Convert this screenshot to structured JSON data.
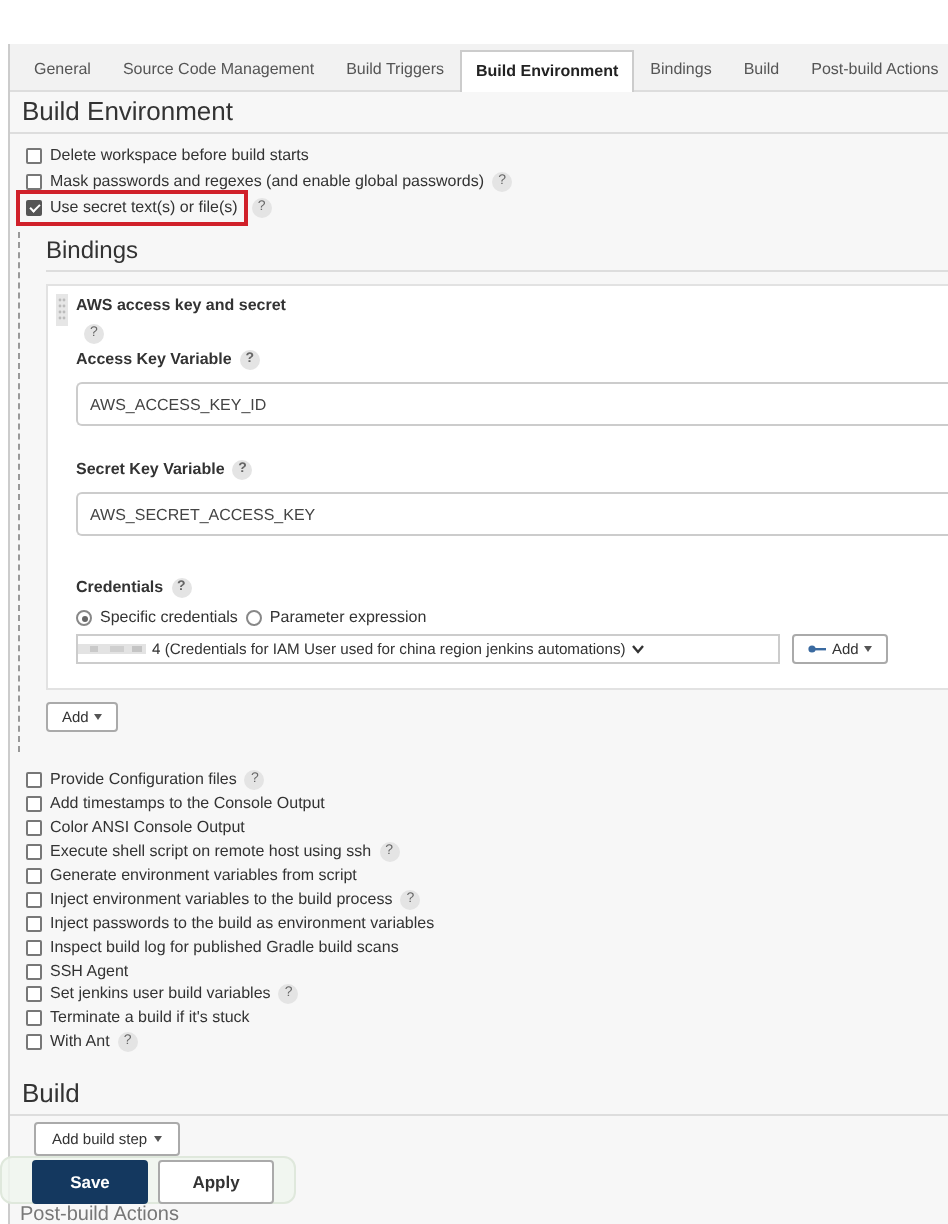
{
  "tabs": [
    {
      "label": "General",
      "selected": false
    },
    {
      "label": "Source Code Management",
      "selected": false
    },
    {
      "label": "Build Triggers",
      "selected": false
    },
    {
      "label": "Build Environment",
      "selected": true
    },
    {
      "label": "Bindings",
      "selected": false
    },
    {
      "label": "Build",
      "selected": false
    },
    {
      "label": "Post-build Actions",
      "selected": false
    }
  ],
  "build_environment": {
    "title": "Build Environment",
    "options": [
      {
        "label": "Delete workspace before build starts",
        "checked": false,
        "highlighted": false
      },
      {
        "label": "Mask passwords and regexes (and enable global passwords)",
        "checked": false,
        "highlighted": false,
        "help": "?"
      },
      {
        "label": "Use secret text(s) or file(s)",
        "checked": true,
        "highlighted": true,
        "help": "?"
      }
    ]
  },
  "bindings": {
    "title": "Bindings",
    "binding": {
      "title": "AWS access key and secret",
      "help": "?",
      "fields": [
        {
          "label": "Access Key Variable",
          "help": "?",
          "value": "AWS_ACCESS_KEY_ID"
        },
        {
          "label": "Secret Key Variable",
          "help": "?",
          "value": "AWS_SECRET_ACCESS_KEY"
        }
      ],
      "credentials": {
        "label": "Credentials",
        "help": "?",
        "options": [
          {
            "label": "Specific credentials",
            "selected": true
          },
          {
            "label": "Parameter expression",
            "selected": false
          }
        ],
        "value": "4 (Credentials for IAM User used for china region jenkins automations)",
        "add_button": "Add"
      }
    },
    "add_button": "Add"
  },
  "more_options": [
    {
      "label": "Provide Configuration files",
      "checked": false,
      "help": "?"
    },
    {
      "label": "Add timestamps to the Console Output",
      "checked": false
    },
    {
      "label": "Color ANSI Console Output",
      "checked": false
    },
    {
      "label": "Execute shell script on remote host using ssh",
      "checked": false,
      "help": "?"
    },
    {
      "label": "Generate environment variables from script",
      "checked": false
    },
    {
      "label": "Inject environment variables to the build process",
      "checked": false,
      "help": "?"
    },
    {
      "label": "Inject passwords to the build as environment variables",
      "checked": false
    },
    {
      "label": "Inspect build log for published Gradle build scans",
      "checked": false
    },
    {
      "label": "SSH Agent",
      "checked": false
    },
    {
      "label": "Set jenkins user build variables",
      "checked": false,
      "help": "?"
    },
    {
      "label": "Terminate a build if it's stuck",
      "checked": false
    },
    {
      "label": "With Ant",
      "checked": false,
      "help": "?"
    }
  ],
  "build": {
    "title": "Build",
    "add_step_button": "Add build step"
  },
  "post_build": {
    "title": "Post-build Actions"
  },
  "save_bar": {
    "buttons": [
      {
        "label": "Save",
        "kind": "primary"
      },
      {
        "label": "Apply",
        "kind": "secondary"
      }
    ]
  }
}
